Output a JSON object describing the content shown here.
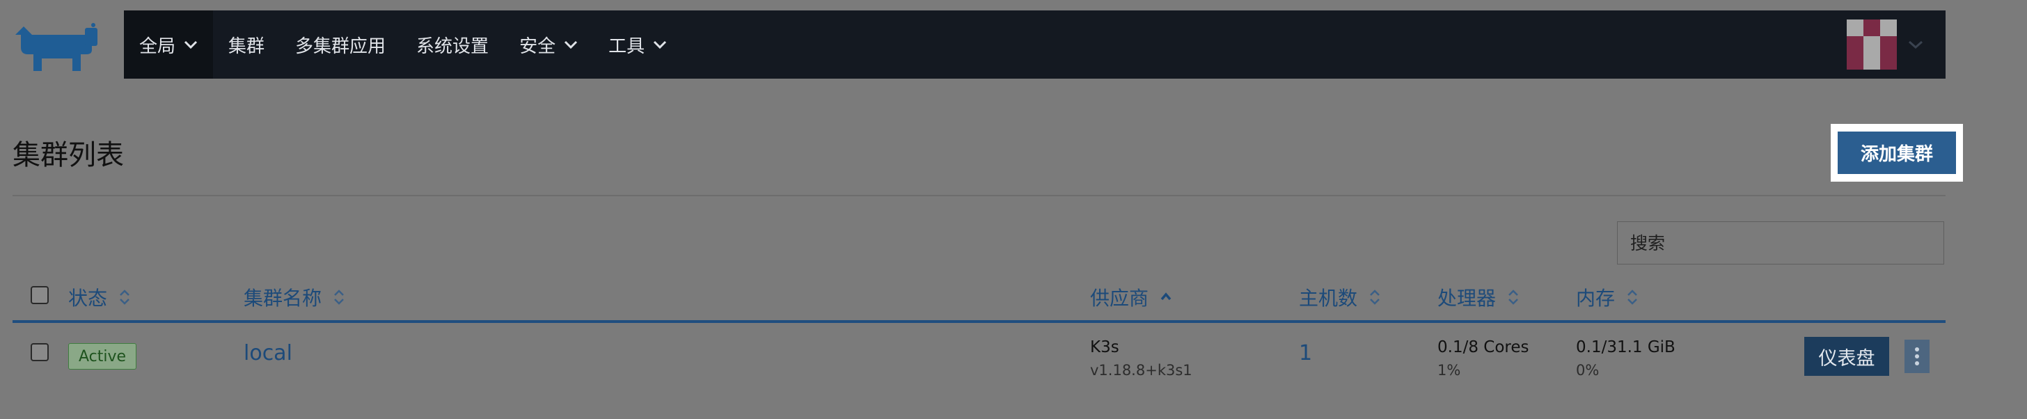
{
  "nav": {
    "items": [
      {
        "label": "全局",
        "has_dropdown": true,
        "active": true
      },
      {
        "label": "集群",
        "has_dropdown": false
      },
      {
        "label": "多集群应用",
        "has_dropdown": false
      },
      {
        "label": "系统设置",
        "has_dropdown": false
      },
      {
        "label": "安全",
        "has_dropdown": true
      },
      {
        "label": "工具",
        "has_dropdown": true
      }
    ],
    "logo_icon": "rancher-cow-logo",
    "avatar_icon": "user-avatar-identicon"
  },
  "page": {
    "title": "集群列表",
    "add_button": "添加集群"
  },
  "search": {
    "placeholder": "搜索",
    "value": ""
  },
  "table": {
    "columns": [
      {
        "label": "状态",
        "sort": "none"
      },
      {
        "label": "集群名称",
        "sort": "none"
      },
      {
        "label": "供应商",
        "sort": "ascending"
      },
      {
        "label": "主机数",
        "sort": "none"
      },
      {
        "label": "处理器",
        "sort": "none"
      },
      {
        "label": "内存",
        "sort": "none"
      }
    ],
    "rows": [
      {
        "state": "Active",
        "name": "local",
        "provider": "K3s",
        "provider_version": "v1.18.8+k3s1",
        "nodes": "1",
        "cpu": "0.1/8 Cores",
        "cpu_pct": "1%",
        "memory": "0.1/31.1 GiB",
        "memory_pct": "0%",
        "action_label": "仪表盘"
      }
    ]
  },
  "colors": {
    "nav_bg": "#141921",
    "accent": "#2b5e90",
    "link": "#1c4a7a",
    "active_badge": "#3f7d3f",
    "overlay_bg": "#7b7b7b"
  }
}
